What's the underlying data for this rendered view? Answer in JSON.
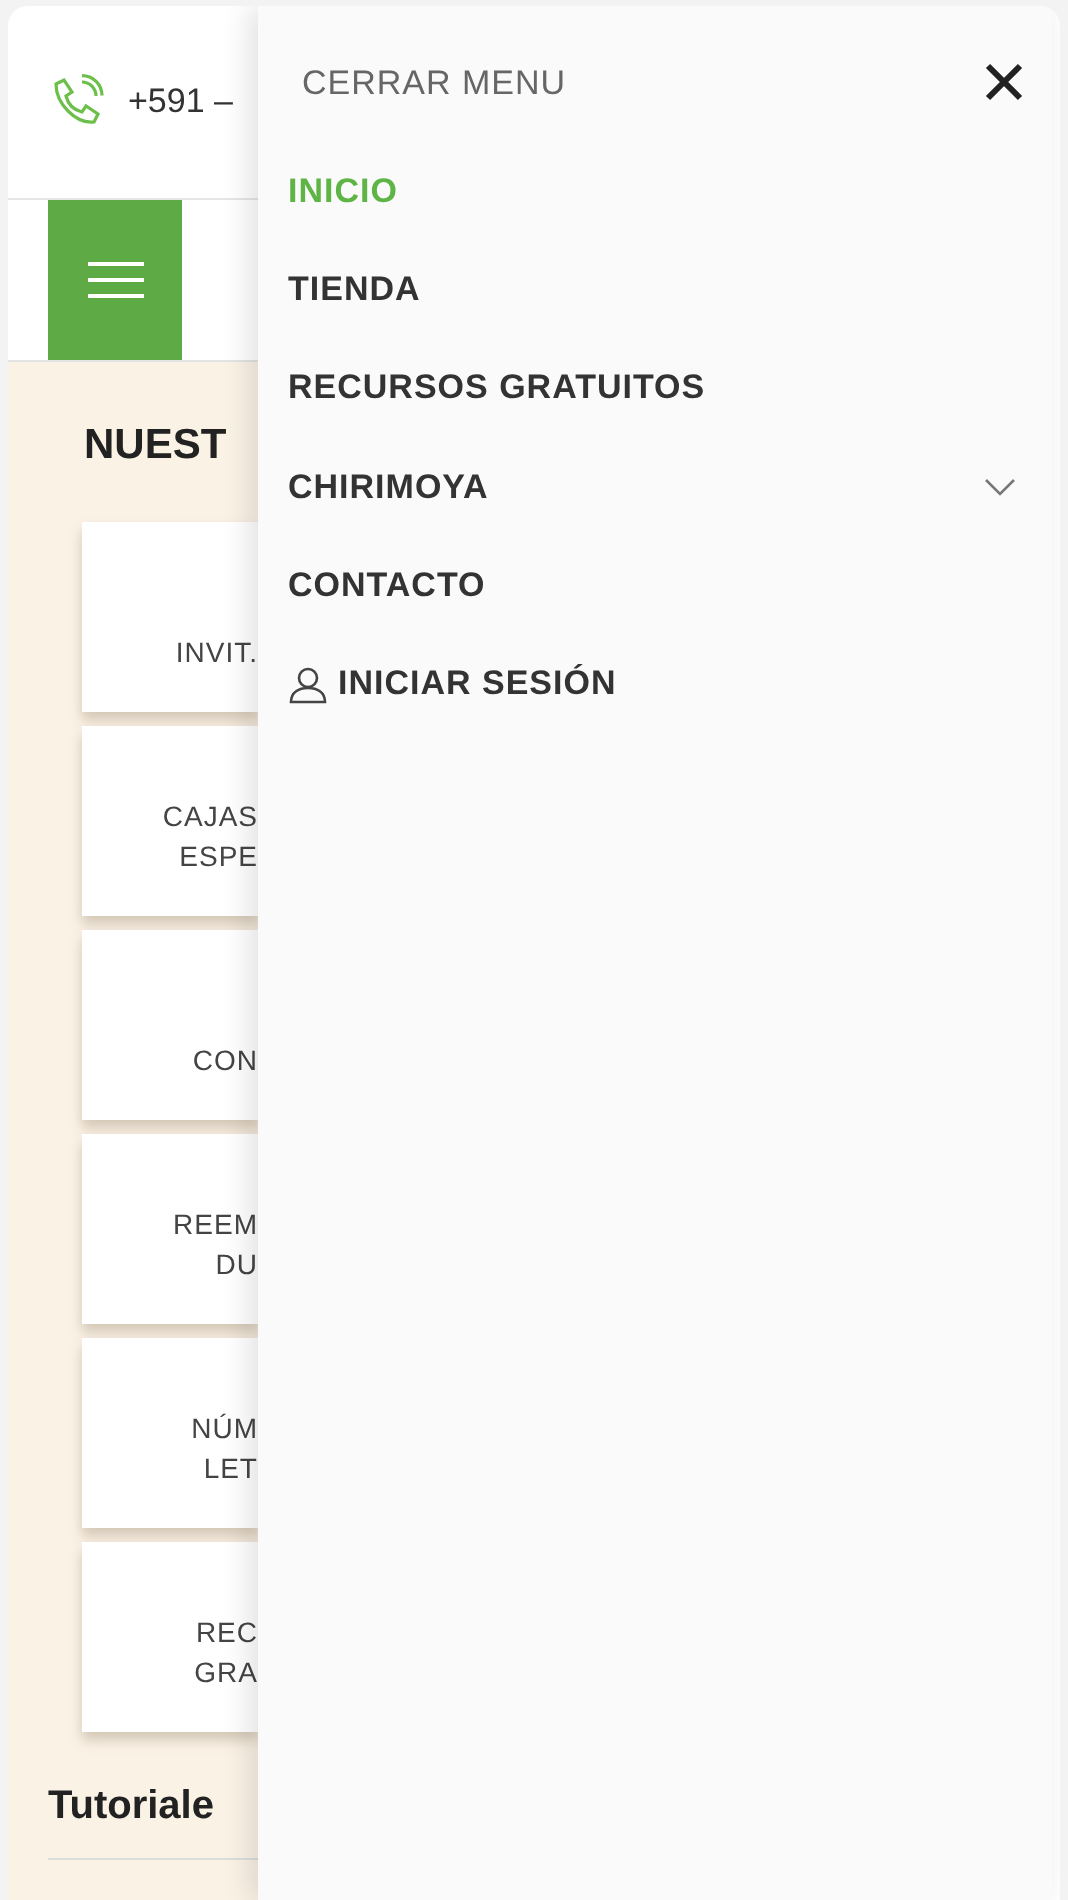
{
  "header": {
    "phone": "+591 –"
  },
  "section": {
    "title": "NUEST",
    "cards": [
      {
        "lines": [
          "INVIT."
        ]
      },
      {
        "lines": [
          "CAJAS",
          "ESPE"
        ]
      },
      {
        "lines": [
          "CON"
        ]
      },
      {
        "lines": [
          "REEM",
          "DU"
        ]
      },
      {
        "lines": [
          "NÚM",
          "LET"
        ]
      },
      {
        "lines": [
          "REC",
          "GRA"
        ]
      }
    ]
  },
  "tutorials": {
    "title": "Tutoriale"
  },
  "drawer": {
    "close_label": "CERRAR MENU",
    "items": [
      {
        "label": "INICIO",
        "kind": "link",
        "selected": true
      },
      {
        "label": "TIENDA",
        "kind": "link",
        "selected": false
      },
      {
        "label": "RECURSOS GRATUITOS",
        "kind": "link",
        "selected": false
      },
      {
        "label": "CHIRIMOYA",
        "kind": "submenu",
        "selected": false,
        "expanded": false
      },
      {
        "label": "CONTACTO",
        "kind": "link",
        "selected": false
      },
      {
        "label": "INICIAR SESIÓN",
        "kind": "account",
        "selected": false
      }
    ]
  }
}
